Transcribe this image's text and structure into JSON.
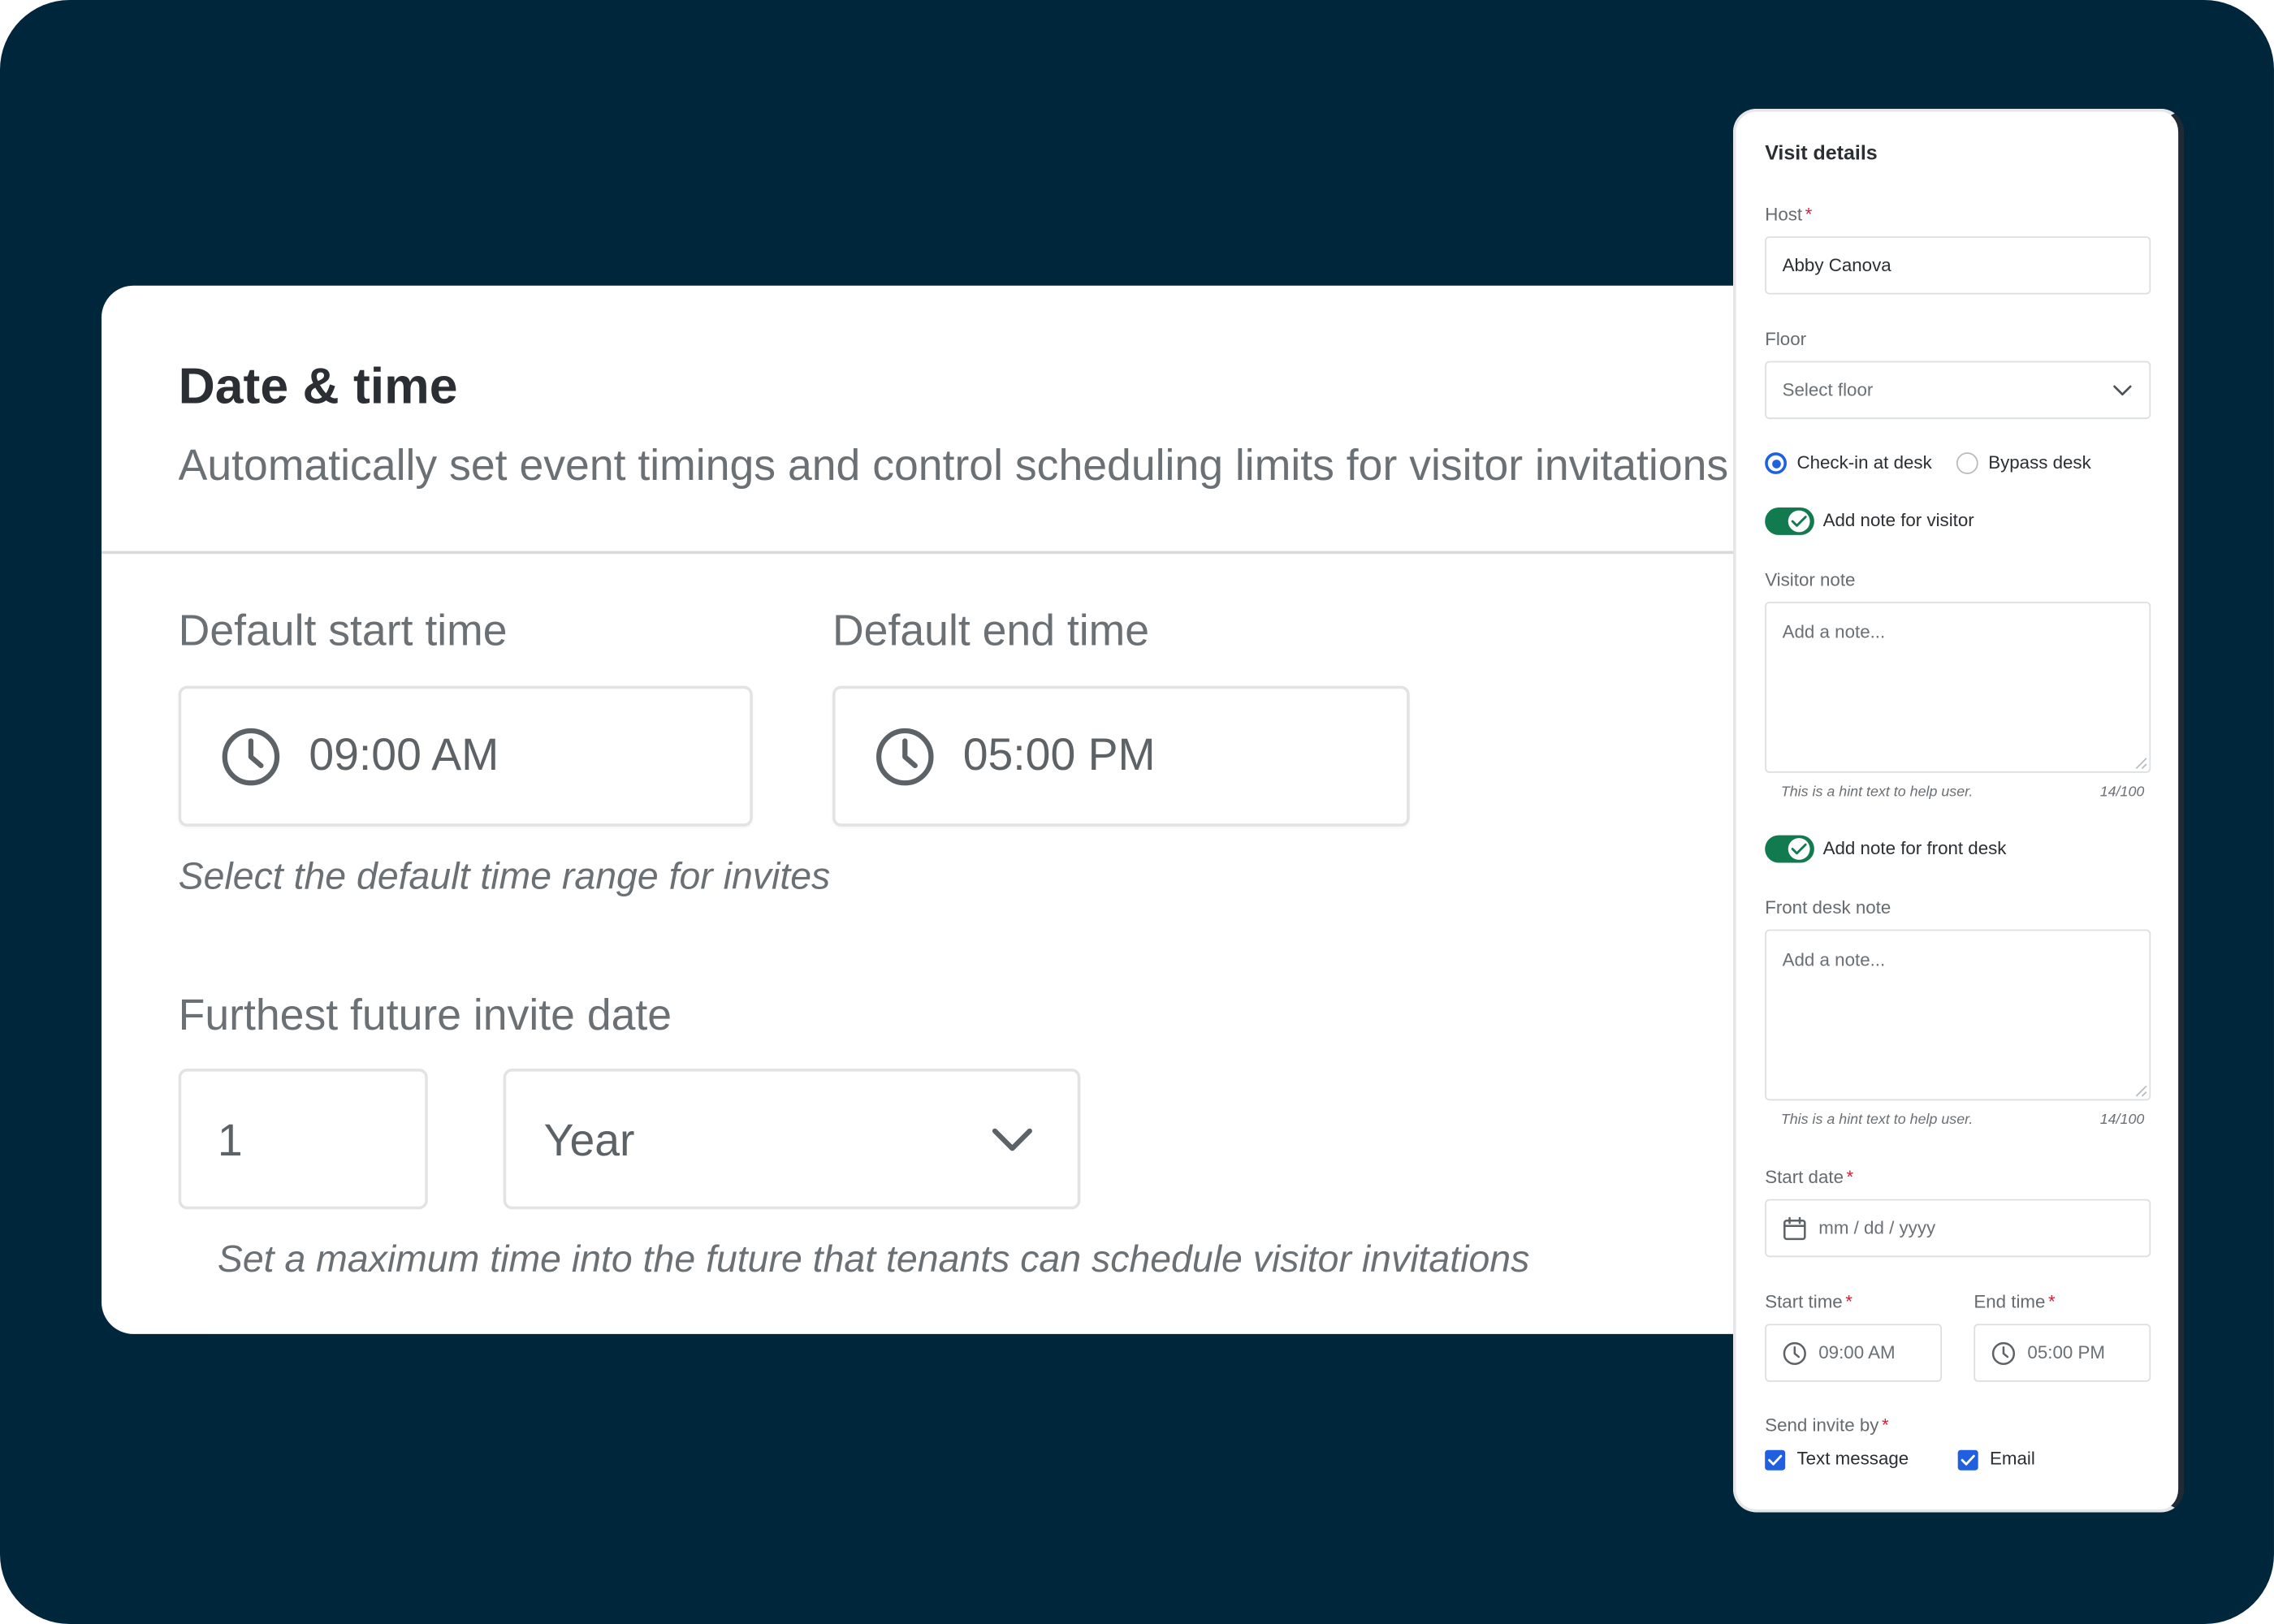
{
  "date_time": {
    "title": "Date & time",
    "subtitle": "Automatically set event timings and control scheduling limits for visitor invitations",
    "start_label": "Default start time",
    "start_value": "09:00 AM",
    "end_label": "Default end time",
    "end_value": "05:00 PM",
    "range_hint": "Select the default time range for invites",
    "future_label": "Furthest future invite date",
    "future_amount": "1",
    "future_unit": "Year",
    "future_hint": "Set a maximum time into the future that tenants can schedule visitor invitations"
  },
  "visit_details": {
    "title": "Visit details",
    "host_label": "Host",
    "required_mark": "*",
    "host_value": "Abby Canova",
    "floor_label": "Floor",
    "floor_placeholder": "Select floor",
    "radio_checkin": "Check-in at desk",
    "radio_bypass": "Bypass desk",
    "toggle_visitor_note": "Add note for visitor",
    "visitor_note_label": "Visitor note",
    "visitor_note_placeholder": "Add a note...",
    "visitor_note_hint": "This is a hint text to help user.",
    "visitor_note_count": "14/100",
    "toggle_frontdesk_note": "Add note for front desk",
    "frontdesk_note_label": "Front desk note",
    "frontdesk_note_placeholder": "Add a note...",
    "frontdesk_note_hint": "This is a hint text to help user.",
    "frontdesk_note_count": "14/100",
    "start_date_label": "Start date",
    "start_date_placeholder": "mm / dd / yyyy",
    "start_time_label": "Start time",
    "start_time_value": "09:00 AM",
    "end_time_label": "End time",
    "end_time_value": "05:00 PM",
    "send_invite_label": "Send invite by",
    "send_text": "Text message",
    "send_email": "Email"
  },
  "colors": {
    "background": "#00263c",
    "toggle_on": "#127a4f",
    "accent_blue": "#1f5fe0",
    "required": "#d0213a"
  },
  "icons": [
    "clock-icon",
    "chevron-down-icon",
    "calendar-icon",
    "check-icon",
    "resize-grip-icon"
  ]
}
